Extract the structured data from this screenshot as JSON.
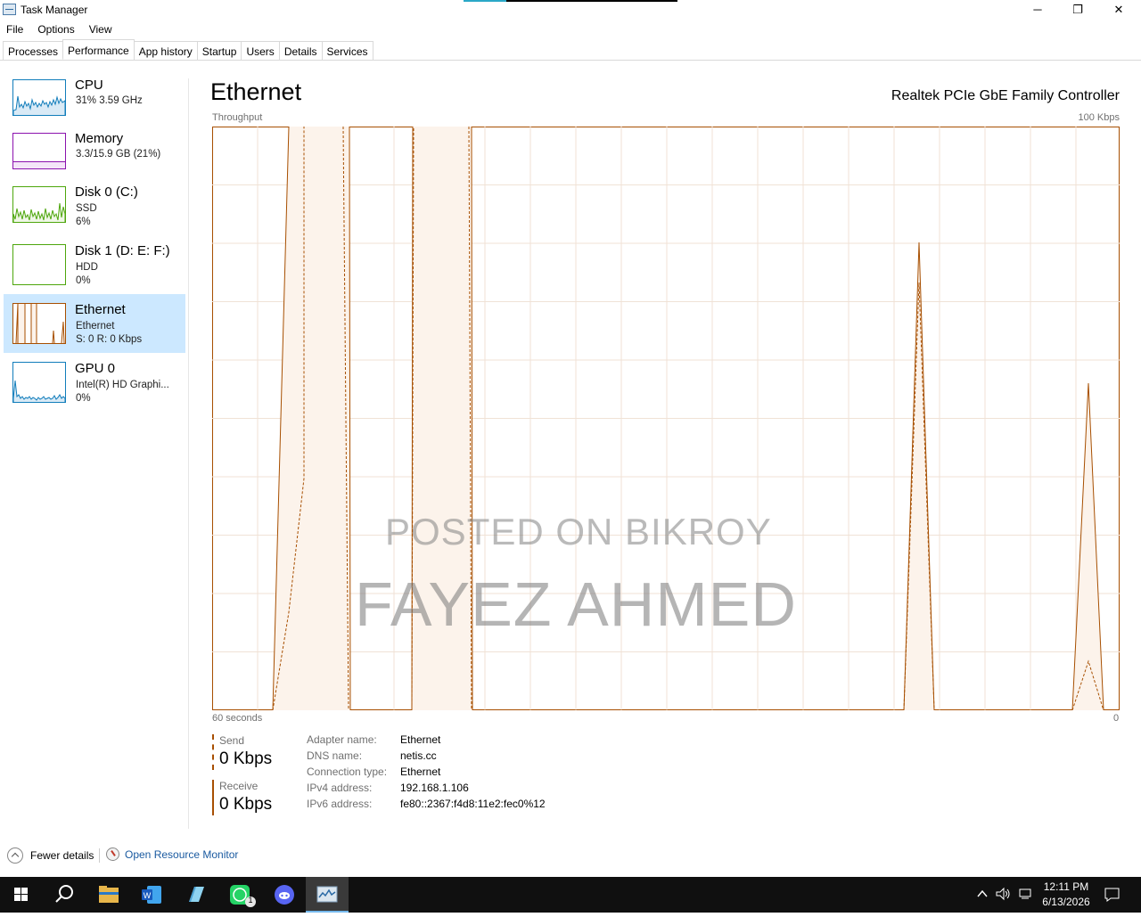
{
  "window": {
    "title": "Task Manager",
    "minimize": "─",
    "maximize": "❐",
    "close": "✕"
  },
  "menu": [
    "File",
    "Options",
    "View"
  ],
  "tabs": [
    "Processes",
    "Performance",
    "App history",
    "Startup",
    "Users",
    "Details",
    "Services"
  ],
  "active_tab": "Performance",
  "sidebar": {
    "items": [
      {
        "name": "CPU",
        "line1": "31% 3.59 GHz",
        "line2": "",
        "color": "#117dbb"
      },
      {
        "name": "Memory",
        "line1": "3.3/15.9 GB (21%)",
        "line2": "",
        "color": "#8b12ae"
      },
      {
        "name": "Disk 0 (C:)",
        "line1": "SSD",
        "line2": "6%",
        "color": "#4da60c"
      },
      {
        "name": "Disk 1 (D: E: F:)",
        "line1": "HDD",
        "line2": "0%",
        "color": "#4da60c"
      },
      {
        "name": "Ethernet",
        "line1": "Ethernet",
        "line2": "S: 0 R: 0 Kbps",
        "color": "#a74f01"
      },
      {
        "name": "GPU 0",
        "line1": "Intel(R) HD Graphi...",
        "line2": "0%",
        "color": "#117dbb"
      }
    ],
    "selected": "Ethernet"
  },
  "main": {
    "title": "Ethernet",
    "adapter": "Realtek PCIe GbE Family Controller",
    "throughput_label": "Throughput",
    "max_label": "100 Kbps",
    "time_label": "60 seconds",
    "zero_label": "0",
    "send_label": "Send",
    "send_value": "0 Kbps",
    "receive_label": "Receive",
    "receive_value": "0 Kbps",
    "properties": [
      {
        "key": "Adapter name:",
        "value": "Ethernet"
      },
      {
        "key": "DNS name:",
        "value": "netis.cc"
      },
      {
        "key": "Connection type:",
        "value": "Ethernet"
      },
      {
        "key": "IPv4 address:",
        "value": "192.168.1.106"
      },
      {
        "key": "IPv6 address:",
        "value": "fe80::2367:f4d8:11e2:fec0%12"
      }
    ],
    "accent_color": "#a74f01",
    "fill_color": "#fcf3eb"
  },
  "watermark": {
    "line1": "POSTED ON BIKROY",
    "line2": "FAYEZ AHMED"
  },
  "footer": {
    "fewer_details": "Fewer details",
    "open_resource_monitor": "Open Resource Monitor"
  },
  "taskbar": {
    "time": "12:11 PM",
    "date": "6/13/2026",
    "whatsapp_badge": "1"
  }
}
